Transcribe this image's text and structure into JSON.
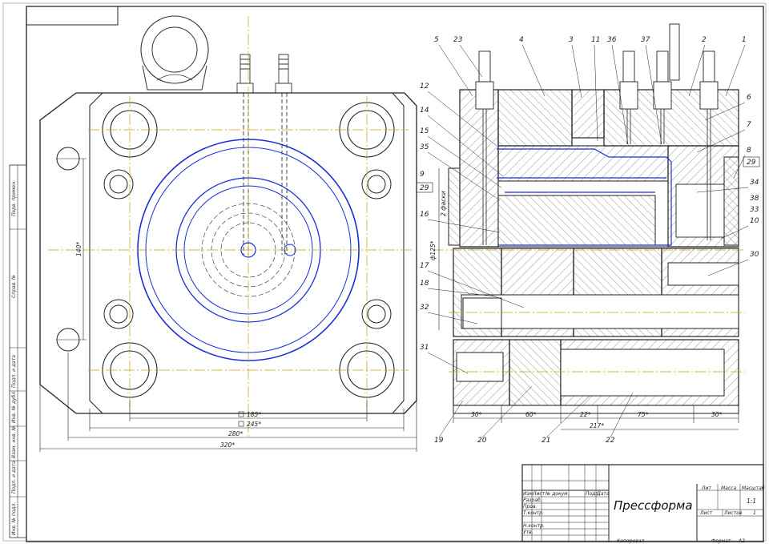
{
  "title_block": {
    "title": "Прессформа",
    "col_lit": "Лит",
    "col_mass": "Масса",
    "col_scale": "Масштаб",
    "scale_value": "1:1",
    "sheet_label": "Лист",
    "sheets_label": "Листов",
    "sheets_value": "1",
    "hdr_izm": "Изм",
    "hdr_list": "Лист",
    "hdr_doc": "№ докум.",
    "hdr_sign": "Подп.",
    "hdr_date": "Дата",
    "role_dev": "Разраб.",
    "role_check": "Пров.",
    "role_tcontr": "Т.контр.",
    "role_ncontr": "Н.контр.",
    "role_appr": "Утв.",
    "copied": "Копировал",
    "format_label": "Формат",
    "format_value": "А2"
  },
  "side_stamp": [
    "Перв. примен.",
    "Справ. №",
    "Подп. и дата",
    "Инв. № дубл.",
    "Взам. инв. №",
    "Подп. и дата",
    "Инв. № подл."
  ],
  "left_view_dims": {
    "d185": "185*",
    "d245": "245*",
    "d280": "280*",
    "d320": "320*",
    "d140": "140*"
  },
  "section_dims": {
    "d30a": "30*",
    "d60": "60*",
    "d22": "22*",
    "d217": "217*",
    "d75": "75*",
    "d30b": "30*",
    "phi125": "ф125*",
    "flat2": "2 фаски"
  },
  "part_labels_top": [
    "5",
    "23",
    "4",
    "3",
    "11",
    "36",
    "37",
    "2",
    "1"
  ],
  "part_labels_left": [
    "12",
    "14",
    "15",
    "35",
    "9",
    "29",
    "16",
    "17",
    "18",
    "32",
    "31"
  ],
  "part_labels_right": [
    "6",
    "7",
    "8",
    "29",
    "34",
    "38",
    "33",
    "10",
    "30"
  ],
  "part_labels_bottom": [
    "19",
    "20",
    "21",
    "22"
  ]
}
